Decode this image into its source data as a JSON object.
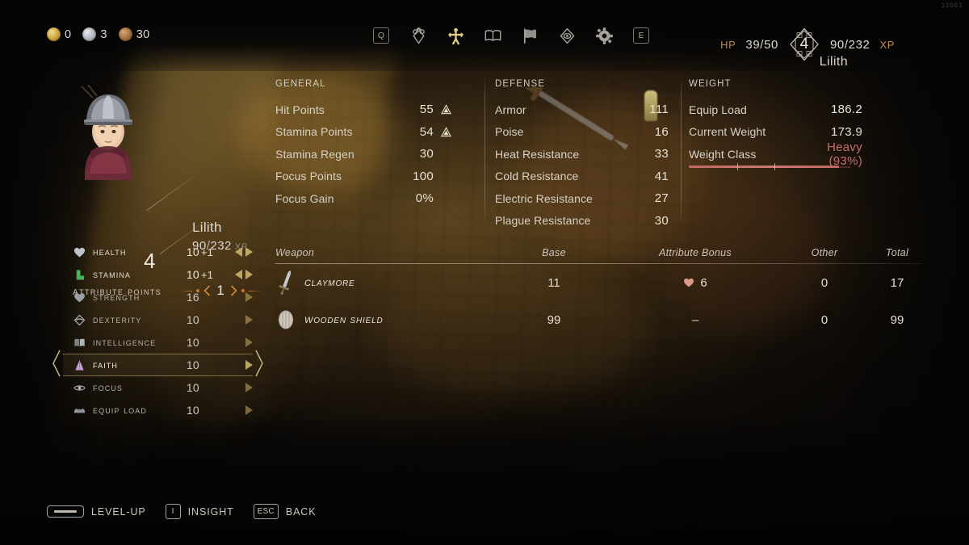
{
  "hud": {
    "debug_counter": "12663",
    "currency": [
      {
        "icon": "gold-coin-icon",
        "value": "0"
      },
      {
        "icon": "silver-coin-icon",
        "value": "3"
      },
      {
        "icon": "bronze-coin-icon",
        "value": "30"
      }
    ],
    "nav_icons": [
      {
        "name": "key-q",
        "label": "Q"
      },
      {
        "name": "inventory-gem-icon",
        "label": ""
      },
      {
        "name": "character-icon",
        "label": ""
      },
      {
        "name": "journal-book-icon",
        "label": ""
      },
      {
        "name": "map-banner-icon",
        "label": ""
      },
      {
        "name": "quest-eye-icon",
        "label": ""
      },
      {
        "name": "settings-gear-icon",
        "label": ""
      },
      {
        "name": "key-e",
        "label": "E"
      }
    ],
    "hp_label": "HP",
    "hp_value": "39/50",
    "level": "4",
    "xp_value": "90/232",
    "xp_label": "XP",
    "player_name": "Lilith"
  },
  "character": {
    "name": "Lilith",
    "xp_current": "90",
    "xp_separator": "/",
    "xp_max": "232",
    "xp_suffix": "XP",
    "level": "4",
    "attribute_points_label": "Attribute Points",
    "attribute_points_value": "1"
  },
  "attributes": [
    {
      "icon": "health-heart-icon",
      "label": "Health",
      "value": "10",
      "bonus": "+1",
      "has_left_arrow": true,
      "dim": false
    },
    {
      "icon": "stamina-boot-icon",
      "label": "Stamina",
      "value": "10",
      "bonus": "+1",
      "has_left_arrow": true,
      "dim": false
    },
    {
      "icon": "strength-icon",
      "label": "Strength",
      "value": "16",
      "bonus": "",
      "has_left_arrow": false,
      "dim": true
    },
    {
      "icon": "dexterity-icon",
      "label": "Dexterity",
      "value": "10",
      "bonus": "",
      "has_left_arrow": false,
      "dim": true
    },
    {
      "icon": "intelligence-icon",
      "label": "Intelligence",
      "value": "10",
      "bonus": "",
      "has_left_arrow": false,
      "dim": true
    },
    {
      "icon": "faith-icon",
      "label": "Faith",
      "value": "10",
      "bonus": "",
      "has_left_arrow": false,
      "dim": false,
      "selected": true
    },
    {
      "icon": "focus-eye-icon",
      "label": "Focus",
      "value": "10",
      "bonus": "",
      "has_left_arrow": false,
      "dim": true
    },
    {
      "icon": "equip-load-icon",
      "label": "Equip Load",
      "value": "10",
      "bonus": "",
      "has_left_arrow": false,
      "dim": true
    }
  ],
  "general": {
    "title": "GENERAL",
    "rows": [
      {
        "label": "Hit Points",
        "value": "55",
        "up": true
      },
      {
        "label": "Stamina Points",
        "value": "54",
        "up": true
      },
      {
        "label": "Stamina Regen",
        "value": "30",
        "up": false
      },
      {
        "label": "Focus Points",
        "value": "100",
        "up": false
      },
      {
        "label": "Focus Gain",
        "value": "0%",
        "up": false
      }
    ]
  },
  "defense": {
    "title": "DEFENSE",
    "rows": [
      {
        "label": "Armor",
        "value": "111"
      },
      {
        "label": "Poise",
        "value": "16"
      },
      {
        "label": "Heat Resistance",
        "value": "33"
      },
      {
        "label": "Cold Resistance",
        "value": "41"
      },
      {
        "label": "Electric Resistance",
        "value": "27"
      },
      {
        "label": "Plague Resistance",
        "value": "30"
      }
    ]
  },
  "weight": {
    "title": "WEIGHT",
    "rows": [
      {
        "label": "Equip Load",
        "value": "186.2"
      },
      {
        "label": "Current Weight",
        "value": "173.9"
      },
      {
        "label": "Weight Class",
        "value": "Heavy  (93%)",
        "class_color": "#c9706b"
      }
    ],
    "bar_percent": 93,
    "bar_ticks": [
      30,
      53
    ],
    "bar_color": "#c06964"
  },
  "weapon_table": {
    "headers": {
      "weapon": "Weapon",
      "base": "Base",
      "attribute_bonus": "Attribute Bonus",
      "other": "Other",
      "total": "Total"
    },
    "rows": [
      {
        "icon": "sword-icon",
        "name": "Claymore",
        "base": "11",
        "bonus_icon": "strength-icon",
        "bonus": "6",
        "other": "0",
        "total": "17"
      },
      {
        "icon": "round-shield-icon",
        "name": "Wooden Shield",
        "base": "99",
        "bonus_icon": "",
        "bonus": "–",
        "other": "0",
        "total": "99"
      }
    ]
  },
  "footer": {
    "hints": [
      {
        "key": "space",
        "key_label": "",
        "label": "LEVEL-UP"
      },
      {
        "key": "i",
        "key_label": "I",
        "label": "INSIGHT"
      },
      {
        "key": "esc",
        "key_label": "ESC",
        "label": "BACK"
      }
    ]
  }
}
